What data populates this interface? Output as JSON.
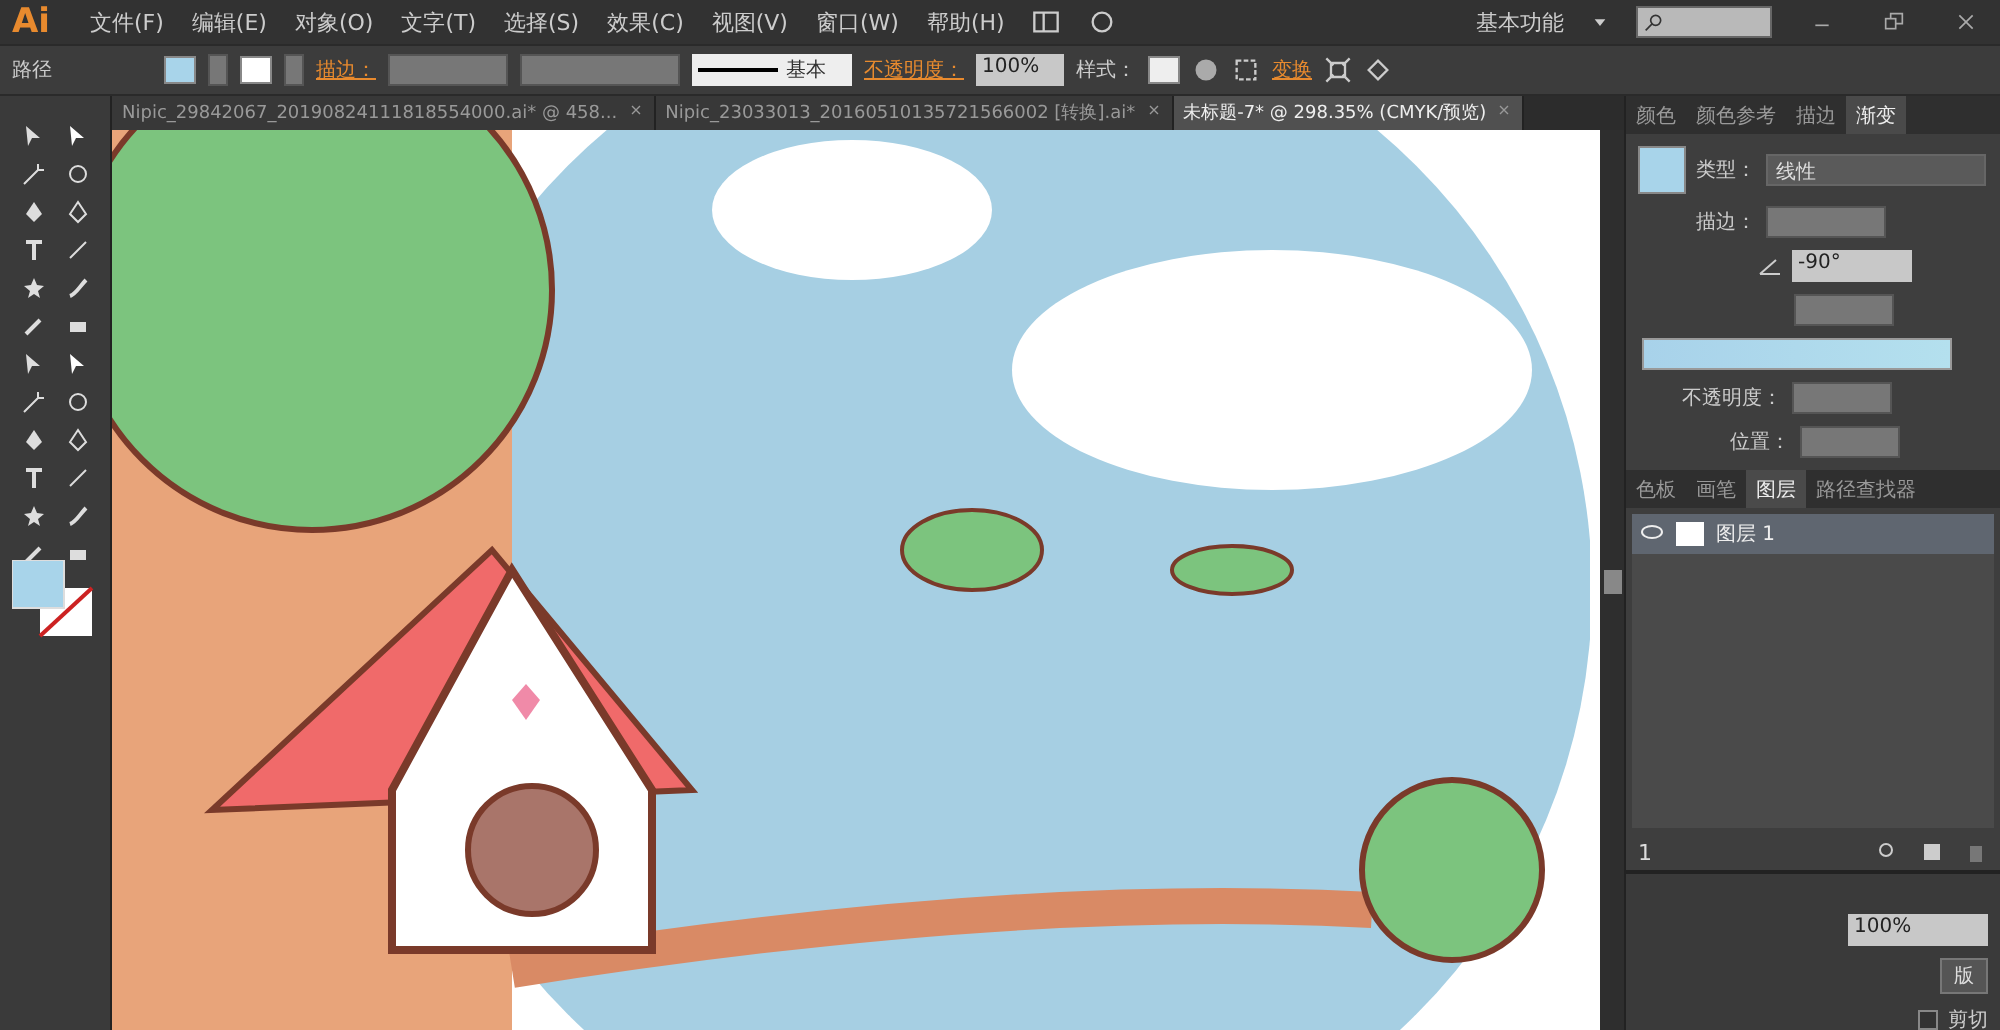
{
  "app": {
    "logo": "Ai"
  },
  "menu": [
    "文件(F)",
    "编辑(E)",
    "对象(O)",
    "文字(T)",
    "选择(S)",
    "效果(C)",
    "视图(V)",
    "窗口(W)",
    "帮助(H)"
  ],
  "workspace": {
    "label": "基本功能"
  },
  "control_bar": {
    "selection": "路径",
    "stroke_label": "描边：",
    "stroke_style": "基本",
    "opacity_label": "不透明度：",
    "opacity": "100%",
    "style_label": "样式：",
    "transform": "变换"
  },
  "doc_tabs": [
    {
      "title": "Nipic_29842067_20190824111818554000.ai* @ 458...",
      "selected": false
    },
    {
      "title": "Nipic_23033013_20160510135721566002 [转换].ai*",
      "selected": false
    },
    {
      "title": "未标题-7* @ 298.35% (CMYK/预览)",
      "selected": true
    }
  ],
  "gradient_panel": {
    "tabs": [
      {
        "label": "颜色",
        "selected": false
      },
      {
        "label": "颜色参考",
        "selected": false
      },
      {
        "label": "描边",
        "selected": false
      },
      {
        "label": "渐变",
        "selected": true
      }
    ],
    "type_label": "类型：",
    "type": "线性",
    "stroke_label": "描边：",
    "angle": "-90°",
    "opacity_label": "不透明度：",
    "position_label": "位置："
  },
  "layers_panel": {
    "tabs": [
      {
        "label": "色板",
        "selected": false
      },
      {
        "label": "画笔",
        "selected": false
      },
      {
        "label": "图层",
        "selected": true
      },
      {
        "label": "路径查找器",
        "selected": false
      }
    ],
    "layers": [
      {
        "name": "图层 1",
        "visible": true
      }
    ],
    "count": "1"
  },
  "bottom_panel": {
    "opacity": "100%",
    "button": "版",
    "clip_label": "剪切",
    "clip_checked": false
  }
}
